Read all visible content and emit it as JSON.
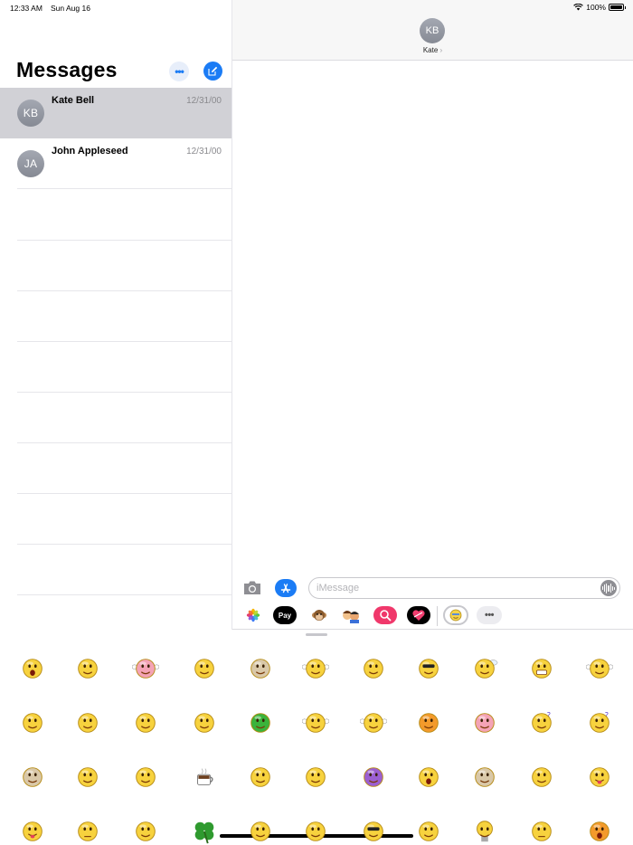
{
  "status_bar": {
    "time": "12:33 AM",
    "date": "Sun Aug 16",
    "battery": "100%"
  },
  "sidebar": {
    "title": "Messages",
    "conversations": [
      {
        "initials": "KB",
        "name": "Kate Bell",
        "timestamp": "12/31/00",
        "selected": true
      },
      {
        "initials": "JA",
        "name": "John Appleseed",
        "timestamp": "12/31/00",
        "selected": false
      }
    ]
  },
  "conversation": {
    "initials": "KB",
    "name": "Kate",
    "chevron": "›"
  },
  "composer": {
    "placeholder": "iMessage"
  },
  "app_drawer": {
    "items": [
      "photos-app-icon",
      "apple-pay-icon",
      "animoji-icon",
      "memoji-stickers-icon",
      "search-images-icon",
      "digital-touch-icon",
      "sticker-pack-icon",
      "more-apps-icon"
    ],
    "apple_pay_label": "Pay"
  },
  "sticker_grid": {
    "rows": 4,
    "columns": 12,
    "stickers": [
      "shocked-smiley",
      "angel-smiley",
      "pink-bone-smiley",
      "thinking-smiley",
      "red-hair-face",
      "waving-smiley",
      "rolling-eyes-smiley",
      "pirate-smiley",
      "bee-smiley",
      "grinning-smiley",
      "hug-smiley",
      "blonde-smiley",
      "blushing-smiley",
      "stop-hand-smiley",
      "boxing-smiley",
      "green-frog",
      "thumbs-smiley",
      "pointing-smiley",
      "chicken-face",
      "pig-face",
      "question-smiley",
      "question-smiley-2",
      "cow-face",
      "crowned-smiley",
      "zipped-mouth-smiley",
      "coffee-cup",
      "walking-smiley",
      "cheering-smiley",
      "purple-devil",
      "yawning-smiley",
      "dog-face",
      "winking-smiley",
      "tongue-smiley",
      "tongue-out-smiley",
      "neutral-smiley",
      "nerd-smiley",
      "four-leaf-clover",
      "ninja-smiley",
      "laptop-smiley",
      "cool-smiley",
      "praying-hands",
      "light-bulb-smiley",
      "sad-smiley",
      "angry-smiley"
    ]
  }
}
